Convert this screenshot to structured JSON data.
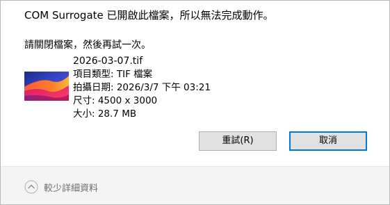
{
  "dialog": {
    "message": "COM Surrogate 已開啟此檔案，所以無法完成動作。",
    "instruction": "請關閉檔案，然後再試一次。"
  },
  "file": {
    "name": "2026-03-07.tif",
    "type_line": "項目類型: TIF 檔案",
    "date_line": "拍攝日期: 2026/3/7 下午 03:21",
    "dimensions_line": "尺寸: 4500 x 3000",
    "size_line": "大小: 28.7 MB",
    "thumbnail_icon": "wallpaper-thumbnail-icon"
  },
  "buttons": {
    "retry_label": "重試(R)",
    "cancel_label": "取消"
  },
  "footer": {
    "details_label": "較少詳細資料",
    "details_icon": "chevron-up-circle-icon"
  },
  "colors": {
    "button_bg": "#e1e1e1",
    "button_border": "#adadad",
    "focus_border": "#0078d7",
    "footer_bg": "#f4f4f4",
    "muted_text": "#6d6d6d"
  }
}
